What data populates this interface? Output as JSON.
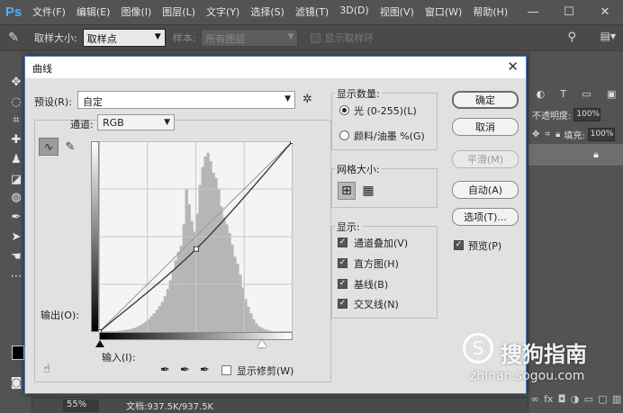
{
  "app": {
    "logo": "Ps",
    "menu": [
      "文件(F)",
      "编辑(E)",
      "图像(I)",
      "图层(L)",
      "文字(Y)",
      "选择(S)",
      "滤镜(T)",
      "3D(D)",
      "视图(V)",
      "窗口(W)",
      "帮助(H)"
    ],
    "window_controls": [
      "—",
      "☐",
      "✕"
    ]
  },
  "options_bar": {
    "sample_size_label": "取样大小:",
    "sample_size_value": "取样点",
    "sample_label": "样本:",
    "sample_value": "所有图层",
    "show_ring_label": "显示取样环"
  },
  "right_panel": {
    "opacity_label": "不透明度:",
    "opacity_value": "100%",
    "fill_label": "填充:",
    "fill_value": "100%"
  },
  "status_bar": {
    "zoom": "55%",
    "doc_info": "文档:937.5K/937.5K"
  },
  "dialog": {
    "title": "曲线",
    "preset_label": "预设(R):",
    "preset_value": "自定",
    "channel_label": "通道:",
    "channel_value": "RGB",
    "output_label": "输出(O):",
    "input_label": "输入(I):",
    "show_clipping_label": "显示修剪(W)",
    "display_amount": {
      "title": "显示数量:",
      "light_label": "光 (0-255)(L)",
      "pigment_label": "颜料/油墨 %(G)",
      "selected": "light"
    },
    "grid_size": {
      "title": "网格大小:"
    },
    "show": {
      "title": "显示:",
      "items": [
        {
          "label": "通道叠加(V)",
          "checked": true
        },
        {
          "label": "直方图(H)",
          "checked": true
        },
        {
          "label": "基线(B)",
          "checked": true
        },
        {
          "label": "交叉线(N)",
          "checked": true
        }
      ]
    },
    "buttons": {
      "ok": "确定",
      "cancel": "取消",
      "smooth": "平滑(M)",
      "auto": "自动(A)",
      "options": "选项(T)..."
    },
    "preview_label": "预览(P)",
    "preview_checked": true,
    "curve_points": [
      [
        0,
        0
      ],
      [
        128,
        111
      ],
      [
        255,
        255
      ]
    ],
    "histogram": [
      0,
      0,
      0,
      0,
      1,
      1,
      1,
      2,
      2,
      3,
      3,
      4,
      5,
      6,
      8,
      10,
      12,
      15,
      18,
      22,
      26,
      31,
      36,
      42,
      50,
      60,
      72,
      85,
      100,
      112,
      120,
      150,
      200,
      178,
      155,
      140,
      165,
      205,
      230,
      245,
      250,
      238,
      222,
      215,
      200,
      175,
      160,
      150,
      138,
      122,
      105,
      95,
      80,
      62,
      46,
      35,
      26,
      18,
      12,
      8,
      6,
      4,
      3,
      2,
      1,
      0,
      0,
      0,
      0,
      0,
      0,
      0
    ]
  },
  "watermark": {
    "logo_glyph": "S",
    "text": "搜狗指南",
    "url": "zhinan.sogou.com"
  }
}
